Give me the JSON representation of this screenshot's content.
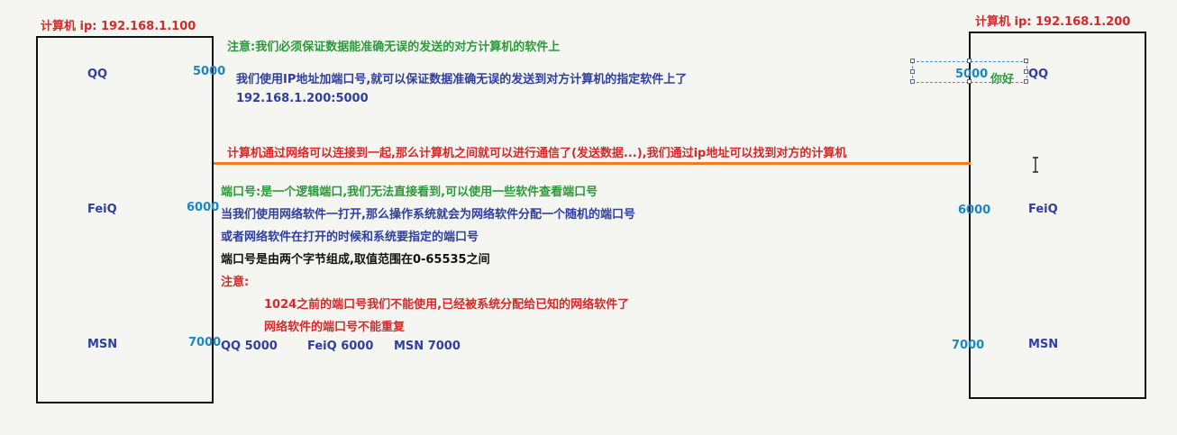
{
  "left_computer": {
    "label": "计算机 ip: 192.168.1.100",
    "apps": [
      {
        "name": "QQ",
        "port": "5000"
      },
      {
        "name": "FeiQ",
        "port": "6000"
      },
      {
        "name": "MSN",
        "port": "7000"
      }
    ]
  },
  "right_computer": {
    "label": "计算机 ip: 192.168.1.200",
    "apps": [
      {
        "name": "QQ",
        "port": "5000"
      },
      {
        "name": "FeiQ",
        "port": "6000"
      },
      {
        "name": "MSN",
        "port": "7000"
      }
    ],
    "message": "你好"
  },
  "notes": {
    "note1": "注意:我们必须保证数据能准确无误的发送的对方计算机的软件上",
    "note2": "我们使用IP地址加端口号,就可以保证数据准确无误的发送到对方计算机的指定软件上了",
    "address": "192.168.1.200:5000",
    "network": "计算机通过网络可以连接到一起,那么计算机之间就可以进行通信了(发送数据...),我们通过ip地址可以找到对方的计算机",
    "port_def": "端口号:是一个逻辑端口,我们无法直接看到,可以使用一些软件查看端口号",
    "port_random": "当我们使用网络软件一打开,那么操作系统就会为网络软件分配一个随机的端口号",
    "port_specify": "或者网络软件在打开的时候和系统要指定的端口号",
    "port_range": "端口号是由两个字节组成,取值范围在0-65535之间",
    "attention": "注意:",
    "rule1": "1024之前的端口号我们不能使用,已经被系统分配给已知的网络软件了",
    "rule2": "网络软件的端口号不能重复"
  },
  "port_summary": [
    "QQ 5000",
    "FeiQ 6000",
    "MSN 7000"
  ],
  "colors": {
    "line": "#f07b26",
    "label_red": "#d42a2a",
    "note_green": "#2a9b3a",
    "text_blue": "#2f3f9e",
    "port_cyan": "#1a87c4"
  }
}
